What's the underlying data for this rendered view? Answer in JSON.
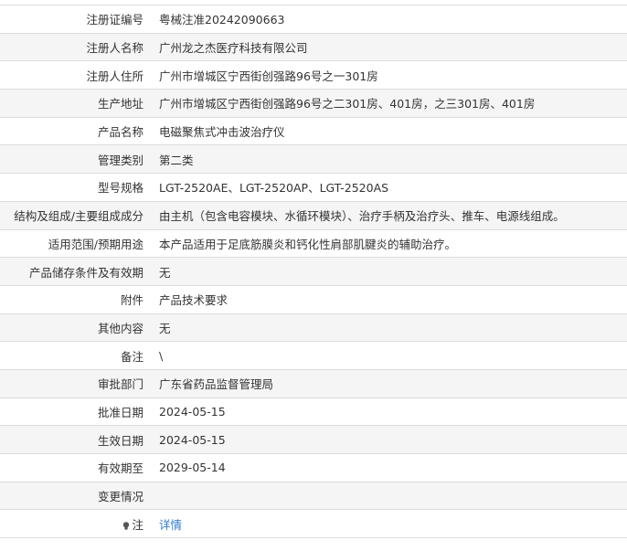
{
  "rows": [
    {
      "label": "注册证编号",
      "value": "粤械注准20242090663"
    },
    {
      "label": "注册人名称",
      "value": "广州龙之杰医疗科技有限公司"
    },
    {
      "label": "注册人住所",
      "value": "广州市增城区宁西街创强路96号之一301房"
    },
    {
      "label": "生产地址",
      "value": "广州市增城区宁西街创强路96号之二301房、401房，之三301房、401房"
    },
    {
      "label": "产品名称",
      "value": "电磁聚焦式冲击波治疗仪"
    },
    {
      "label": "管理类别",
      "value": "第二类"
    },
    {
      "label": "型号规格",
      "value": "LGT-2520AE、LGT-2520AP、LGT-2520AS"
    },
    {
      "label": "结构及组成/主要组成成分",
      "value": "由主机（包含电容模块、水循环模块）、治疗手柄及治疗头、推车、电源线组成。"
    },
    {
      "label": "适用范围/预期用途",
      "value": "本产品适用于足底筋膜炎和钙化性肩部肌腱炎的辅助治疗。"
    },
    {
      "label": "产品储存条件及有效期",
      "value": "无"
    },
    {
      "label": "附件",
      "value": "产品技术要求"
    },
    {
      "label": "其他内容",
      "value": "无"
    },
    {
      "label": "备注",
      "value": "\\"
    },
    {
      "label": "审批部门",
      "value": "广东省药品监督管理局"
    },
    {
      "label": "批准日期",
      "value": "2024-05-15"
    },
    {
      "label": "生效日期",
      "value": "2024-05-15"
    },
    {
      "label": "有效期至",
      "value": "2029-05-14"
    },
    {
      "label": "变更情况",
      "value": ""
    }
  ],
  "note": {
    "label": "注",
    "icon": "lightbulb-icon",
    "link_text": "详情"
  },
  "colors": {
    "row_shade": "#f5f5f5",
    "border": "#dcdcdc",
    "link": "#2e7bcf"
  }
}
